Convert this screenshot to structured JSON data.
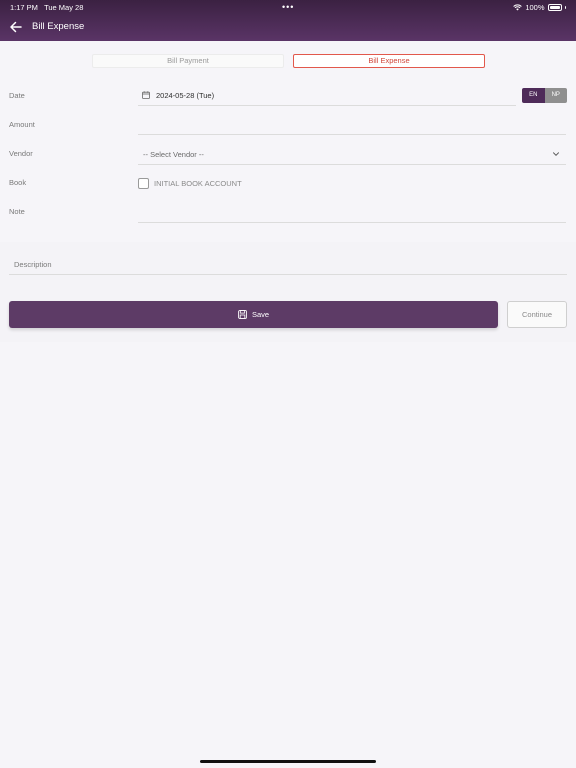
{
  "status_bar": {
    "time": "1:17 PM",
    "date": "Tue May 28",
    "battery": "100%"
  },
  "header": {
    "title": "Bill Expense"
  },
  "tabs": [
    {
      "label": "Bill Payment",
      "active": false
    },
    {
      "label": "Bill Expense",
      "active": true
    }
  ],
  "form": {
    "date_label": "Date",
    "date_value": "2024-05-28 (Tue)",
    "lang_en": "EN",
    "lang_np": "NP",
    "amount_label": "Amount",
    "vendor_label": "Vendor",
    "vendor_placeholder": "-- Select Vendor --",
    "book_label": "Book",
    "book_option": "INITIAL BOOK ACCOUNT",
    "note_label": "Note"
  },
  "description": {
    "placeholder": "Description"
  },
  "actions": {
    "save_label": "Save",
    "continue_label": "Continue"
  },
  "colors": {
    "header": "#4a2a55",
    "accent": "#5d3b66",
    "active_tab_border": "#e2584c"
  }
}
